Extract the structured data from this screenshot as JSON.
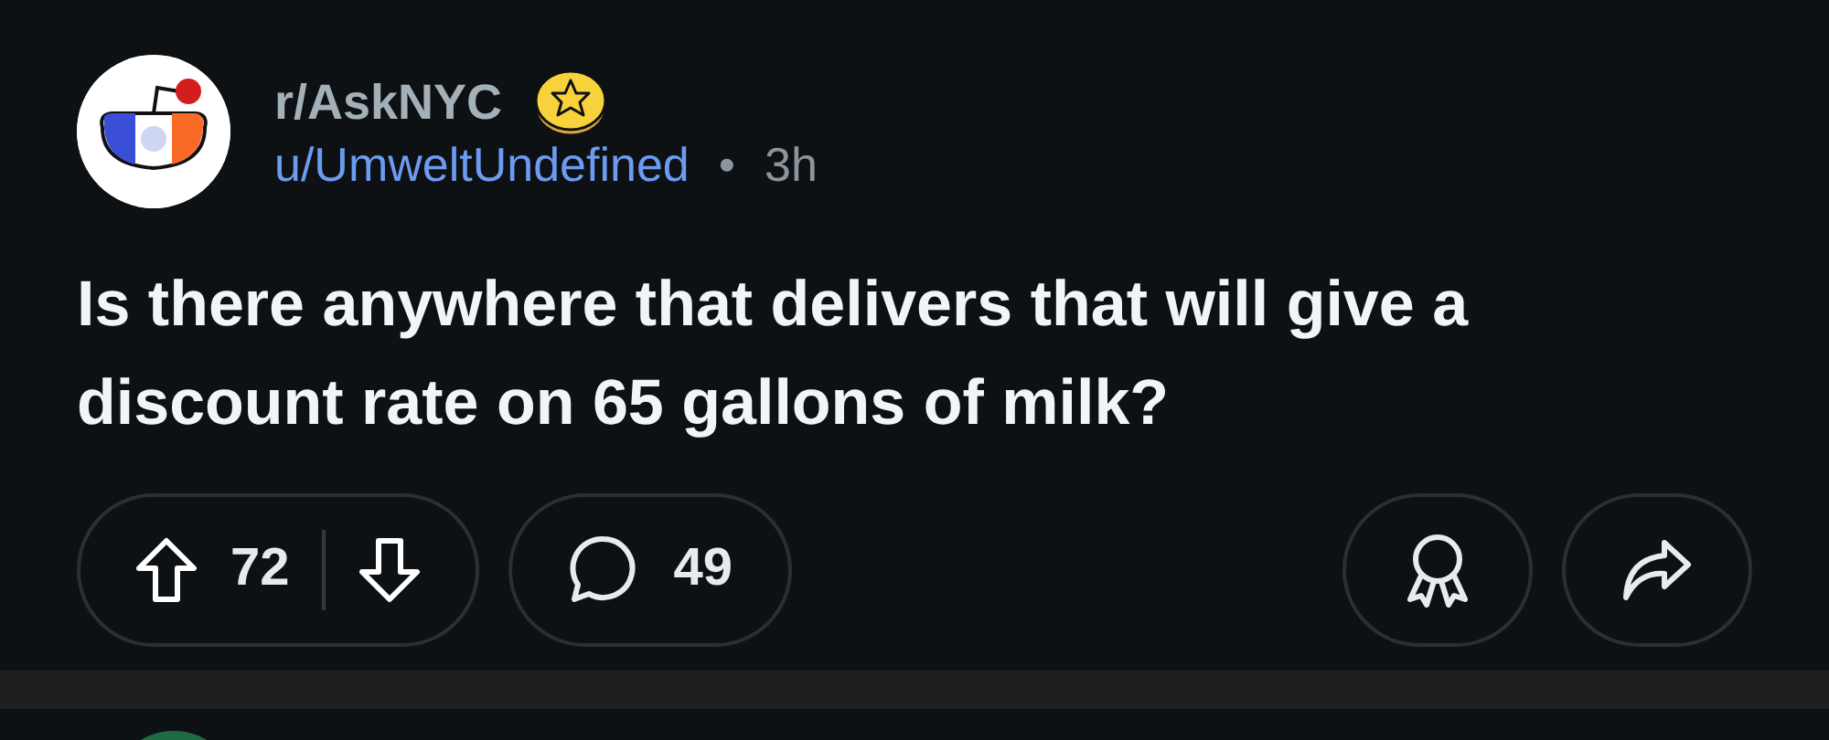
{
  "post": {
    "subreddit": "r/AskNYC",
    "author": "u/UmweltUndefined",
    "separator": "•",
    "time": "3h",
    "title": "Is there anywhere that delivers that will give a discount rate on 65 gallons of milk?",
    "score": "72",
    "comments": "49"
  }
}
